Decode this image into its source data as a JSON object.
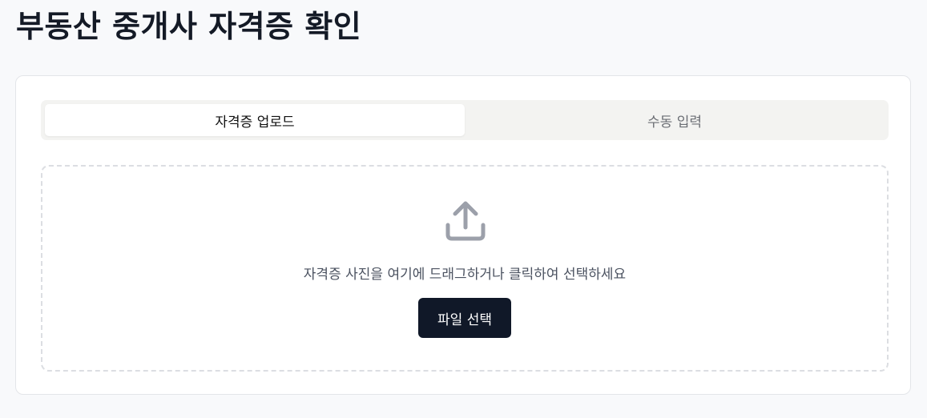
{
  "page": {
    "title": "부동산 중개사 자격증 확인"
  },
  "tabs": [
    {
      "label": "자격증 업로드",
      "active": true
    },
    {
      "label": "수동 입력",
      "active": false
    }
  ],
  "upload": {
    "icon": "upload-icon",
    "hint": "자격증 사진을 여기에 드래그하거나 클릭하여 선택하세요",
    "button_label": "파일 선택"
  },
  "colors": {
    "button_bg": "#101828",
    "icon": "#9ca0aa",
    "page_bg": "#f8f9fb"
  }
}
